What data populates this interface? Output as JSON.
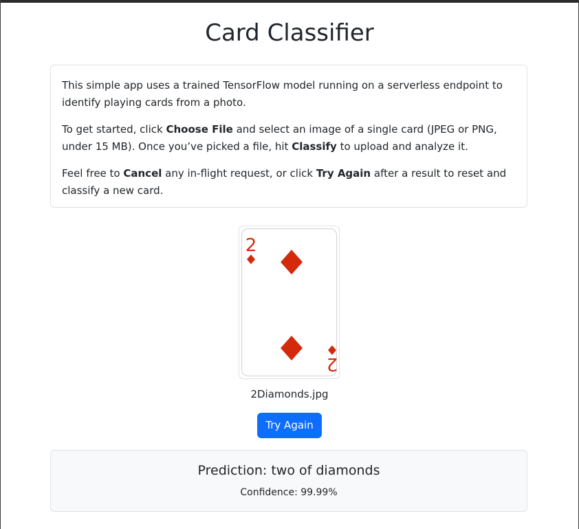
{
  "app": {
    "title": "Card Classifier"
  },
  "intro": {
    "p1": "This simple app uses a trained TensorFlow model running on a serverless endpoint to identify playing cards from a photo.",
    "p2_a": "To get started, click ",
    "p2_b": "Choose File",
    "p2_c": " and select an image of a single card (JPEG or PNG, under 15 MB). Once you’ve picked a file, hit ",
    "p2_d": "Classify",
    "p2_e": " to upload and analyze it.",
    "p3_a": "Feel free to ",
    "p3_b": "Cancel",
    "p3_c": " any in-flight request, or click ",
    "p3_d": "Try Again",
    "p3_e": " after a result to reset and classify a new card."
  },
  "preview": {
    "card_rank": "2",
    "card_suit_icon": "diamond-icon",
    "suit_color": "#d42a0c",
    "file_name": "2Diamonds.jpg"
  },
  "actions": {
    "try_again_label": "Try Again",
    "accent": "#0d6efd"
  },
  "result": {
    "prediction": "Prediction: two of diamonds",
    "confidence": "Confidence: 99.99%"
  }
}
